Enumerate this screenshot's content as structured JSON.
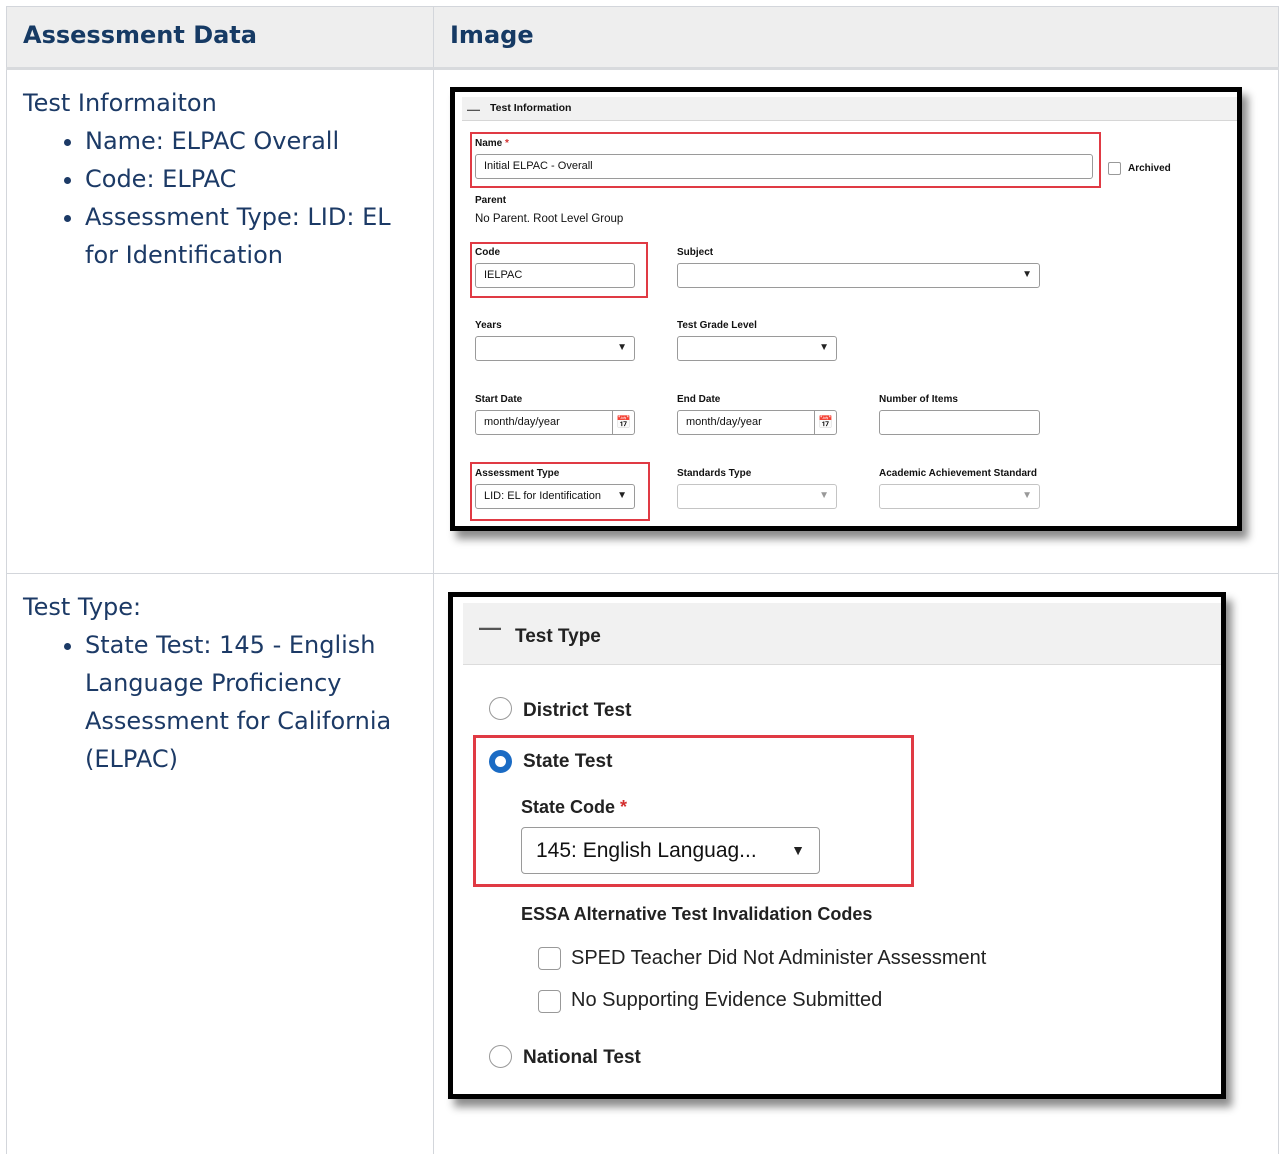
{
  "table": {
    "header_col1": "Assessment Data",
    "header_col2": "Image"
  },
  "row1": {
    "heading": "Test Informaiton",
    "bullets": [
      "Name: ELPAC Overall",
      "Code: ELPAC",
      "Assessment Type: LID: EL for Identification"
    ]
  },
  "row2": {
    "heading": "Test Type:",
    "bullets": [
      " State Test: 145 - English Language Proficiency Assessment for California (ELPAC)"
    ]
  },
  "test_info_screen": {
    "section_title": "Test Information",
    "name_label": "Name",
    "required_mark": "*",
    "name_value": "Initial ELPAC - Overall",
    "archived_label": "Archived",
    "parent_label": "Parent",
    "parent_value": "No Parent. Root Level Group",
    "code_label": "Code",
    "code_value": "IELPAC",
    "subject_label": "Subject",
    "subject_value": "",
    "years_label": "Years",
    "years_value": "",
    "test_grade_level_label": "Test Grade Level",
    "test_grade_level_value": "",
    "start_date_label": "Start Date",
    "start_date_value": "month/day/year",
    "end_date_label": "End Date",
    "end_date_value": "month/day/year",
    "number_of_items_label": "Number of Items",
    "number_of_items_value": "",
    "assessment_type_label": "Assessment Type",
    "assessment_type_value": "LID: EL for Identification",
    "standards_type_label": "Standards Type",
    "standards_type_value": "",
    "academic_achievement_label": "Academic Achievement Standard",
    "academic_achievement_value": ""
  },
  "test_type_screen": {
    "section_title": "Test Type",
    "district_test": "District Test",
    "state_test": "State Test",
    "state_code_label": "State Code",
    "required_mark": "*",
    "state_code_value": "145: English Languag...",
    "essa_label": "ESSA Alternative Test Invalidation Codes",
    "checkbox1": "SPED Teacher Did Not Administer Assessment",
    "checkbox2": "No Supporting Evidence Submitted",
    "national_test": "National Test",
    "selected": "State Test"
  },
  "colors": {
    "highlight_red": "#e03a44",
    "radio_blue": "#1a6bc4",
    "doc_text": "#1c3a66"
  }
}
